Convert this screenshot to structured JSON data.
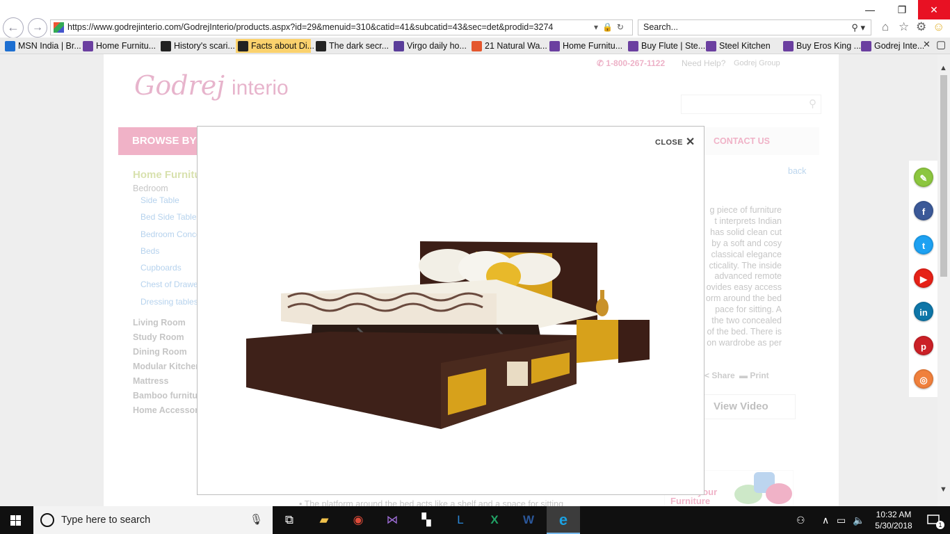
{
  "browser": {
    "url": "https://www.godrejinterio.com/GodrejInterio/products.aspx?id=29&menuid=310&catid=41&subcatid=43&sec=det&prodid=3274",
    "search_placeholder": "Search...",
    "window_controls": {
      "minimize": "—",
      "restore": "❐",
      "close": "✕"
    },
    "favorites": [
      {
        "label": "MSN India | Br...",
        "color": "#1d6fd1"
      },
      {
        "label": "Home Furnitu...",
        "color": "#6b3fa0"
      },
      {
        "label": "History's scari...",
        "color": "#222222"
      },
      {
        "label": "Facts about Di...",
        "color": "#222222",
        "active": true
      },
      {
        "label": "The dark secr...",
        "color": "#222222"
      },
      {
        "label": "Virgo daily ho...",
        "color": "#5a3d9a"
      },
      {
        "label": "21 Natural Wa...",
        "color": "#e4572e"
      },
      {
        "label": "Home Furnitu...",
        "color": "#6b3fa0"
      },
      {
        "label": "Buy Flute | Ste...",
        "color": "#6b3fa0"
      },
      {
        "label": "Steel Kitchen",
        "color": "#6b3fa0"
      },
      {
        "label": "Buy Eros King ...",
        "color": "#6b3fa0"
      },
      {
        "label": "Godrej Inte...",
        "color": "#6b3fa0"
      }
    ]
  },
  "site": {
    "logo_script": "Godrej",
    "logo_word": "interio",
    "phone": "1-800-267-1122",
    "help": "Need Help?",
    "group": "Godrej Group",
    "browse_label": "BROWSE BY",
    "contact": "CONTACT US",
    "back": "back",
    "sidebar": {
      "heading": "Home Furniture",
      "subheading": "Bedroom",
      "items": [
        "Side Table",
        "Bed Side Table",
        "Bedroom Concepts",
        "Beds",
        "Cupboards",
        "Chest of Drawers",
        "Dressing tables"
      ],
      "categories": [
        "Living Room",
        "Study Room",
        "Dining Room",
        "Modular Kitchen",
        "Mattress",
        "Bamboo furniture",
        "Home Accessories"
      ]
    },
    "description_lines": [
      "g piece of furniture",
      "t interprets Indian",
      "has solid clean cut",
      "by a soft and cosy",
      "classical elegance",
      "cticality. The inside",
      "advanced remote",
      "ovides easy access",
      "orm around the bed",
      "pace for sitting. A",
      "the two concealed",
      "of the bed. There is",
      "on wardrobe as per"
    ],
    "share": "Share",
    "print": "Print",
    "view_video": "View Video",
    "bottom_bullet": "The platform around the bed acts like a shelf and a space for sitting",
    "know_line1": "Know your",
    "know_line2": "Furniture"
  },
  "modal": {
    "close_label": "CLOSE",
    "close_icon": "✕",
    "image_alt": "Bed with storage and yellow accents"
  },
  "social": [
    "edit",
    "facebook",
    "twitter",
    "youtube",
    "linkedin",
    "pinterest",
    "instagram"
  ],
  "taskbar": {
    "search_placeholder": "Type here to search",
    "time": "10:32 AM",
    "date": "5/30/2018"
  }
}
